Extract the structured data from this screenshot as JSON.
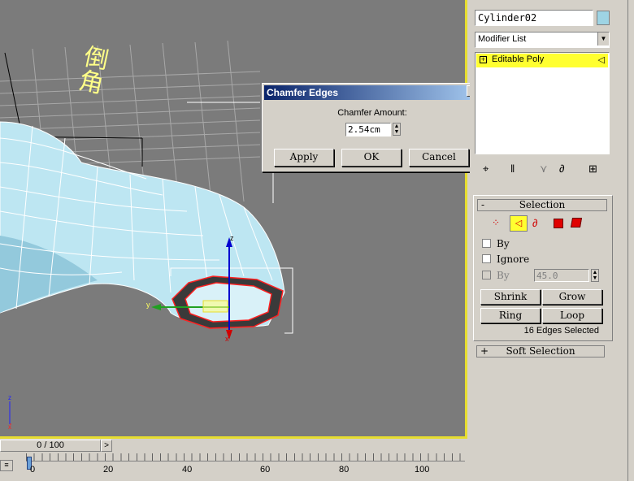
{
  "viewport": {
    "handwriting": "倒角",
    "axis_x": "x",
    "axis_y": "y",
    "axis_z": "z",
    "corner_axis_z": "z",
    "corner_axis_x": "x"
  },
  "dialog": {
    "title": "Chamfer Edges",
    "close": "✕",
    "amount_label": "Chamfer Amount:",
    "amount_value": "2.54cm",
    "apply": "Apply",
    "ok": "OK",
    "cancel": "Cancel"
  },
  "panel": {
    "object_name": "Cylinder02",
    "object_color": "#9ed4e4",
    "modifier_list": "Modifier List",
    "stack_item": "Editable Poly",
    "selection_title": "Selection",
    "selection_minus": "-",
    "by_vertex": "By",
    "ignore": "Ignore",
    "by_angle": "By",
    "angle_value": "45.0",
    "shrink": "Shrink",
    "grow": "Grow",
    "ring": "Ring",
    "loop": "Loop",
    "status": "16 Edges Selected",
    "soft_selection": "Soft Selection",
    "soft_plus": "+"
  },
  "timeline": {
    "frame": "0 / 100",
    "ticks": [
      "0",
      "20",
      "40",
      "60",
      "80",
      "100"
    ]
  }
}
